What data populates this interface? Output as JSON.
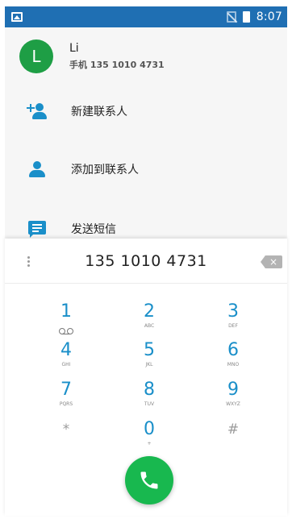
{
  "status_bar": {
    "time": "8:07",
    "icons": [
      "image-icon",
      "no-sim-icon",
      "battery-icon"
    ],
    "color": "#1f6fb3"
  },
  "contact": {
    "avatar_letter": "L",
    "name": "Li",
    "number_line": "手机 135 1010 4731",
    "avatar_color": "#1e9e45"
  },
  "actions": [
    {
      "label": "新建联系人",
      "icon": "add-contact-icon"
    },
    {
      "label": "添加到联系人",
      "icon": "person-icon"
    },
    {
      "label": "发送短信",
      "icon": "message-icon"
    }
  ],
  "dialer": {
    "entered_number": "135 1010 4731",
    "keys": [
      {
        "digit": "1",
        "letters": ""
      },
      {
        "digit": "2",
        "letters": "ABC"
      },
      {
        "digit": "3",
        "letters": "DEF"
      },
      {
        "digit": "4",
        "letters": "GHI"
      },
      {
        "digit": "5",
        "letters": "JKL"
      },
      {
        "digit": "6",
        "letters": "MNO"
      },
      {
        "digit": "7",
        "letters": "PQRS"
      },
      {
        "digit": "8",
        "letters": "TUV"
      },
      {
        "digit": "9",
        "letters": "WXYZ"
      },
      {
        "digit": "*",
        "letters": ""
      },
      {
        "digit": "0",
        "letters": "+"
      },
      {
        "digit": "#",
        "letters": ""
      }
    ],
    "accent_color": "#1a8fc9",
    "call_button_color": "#18b84f"
  }
}
